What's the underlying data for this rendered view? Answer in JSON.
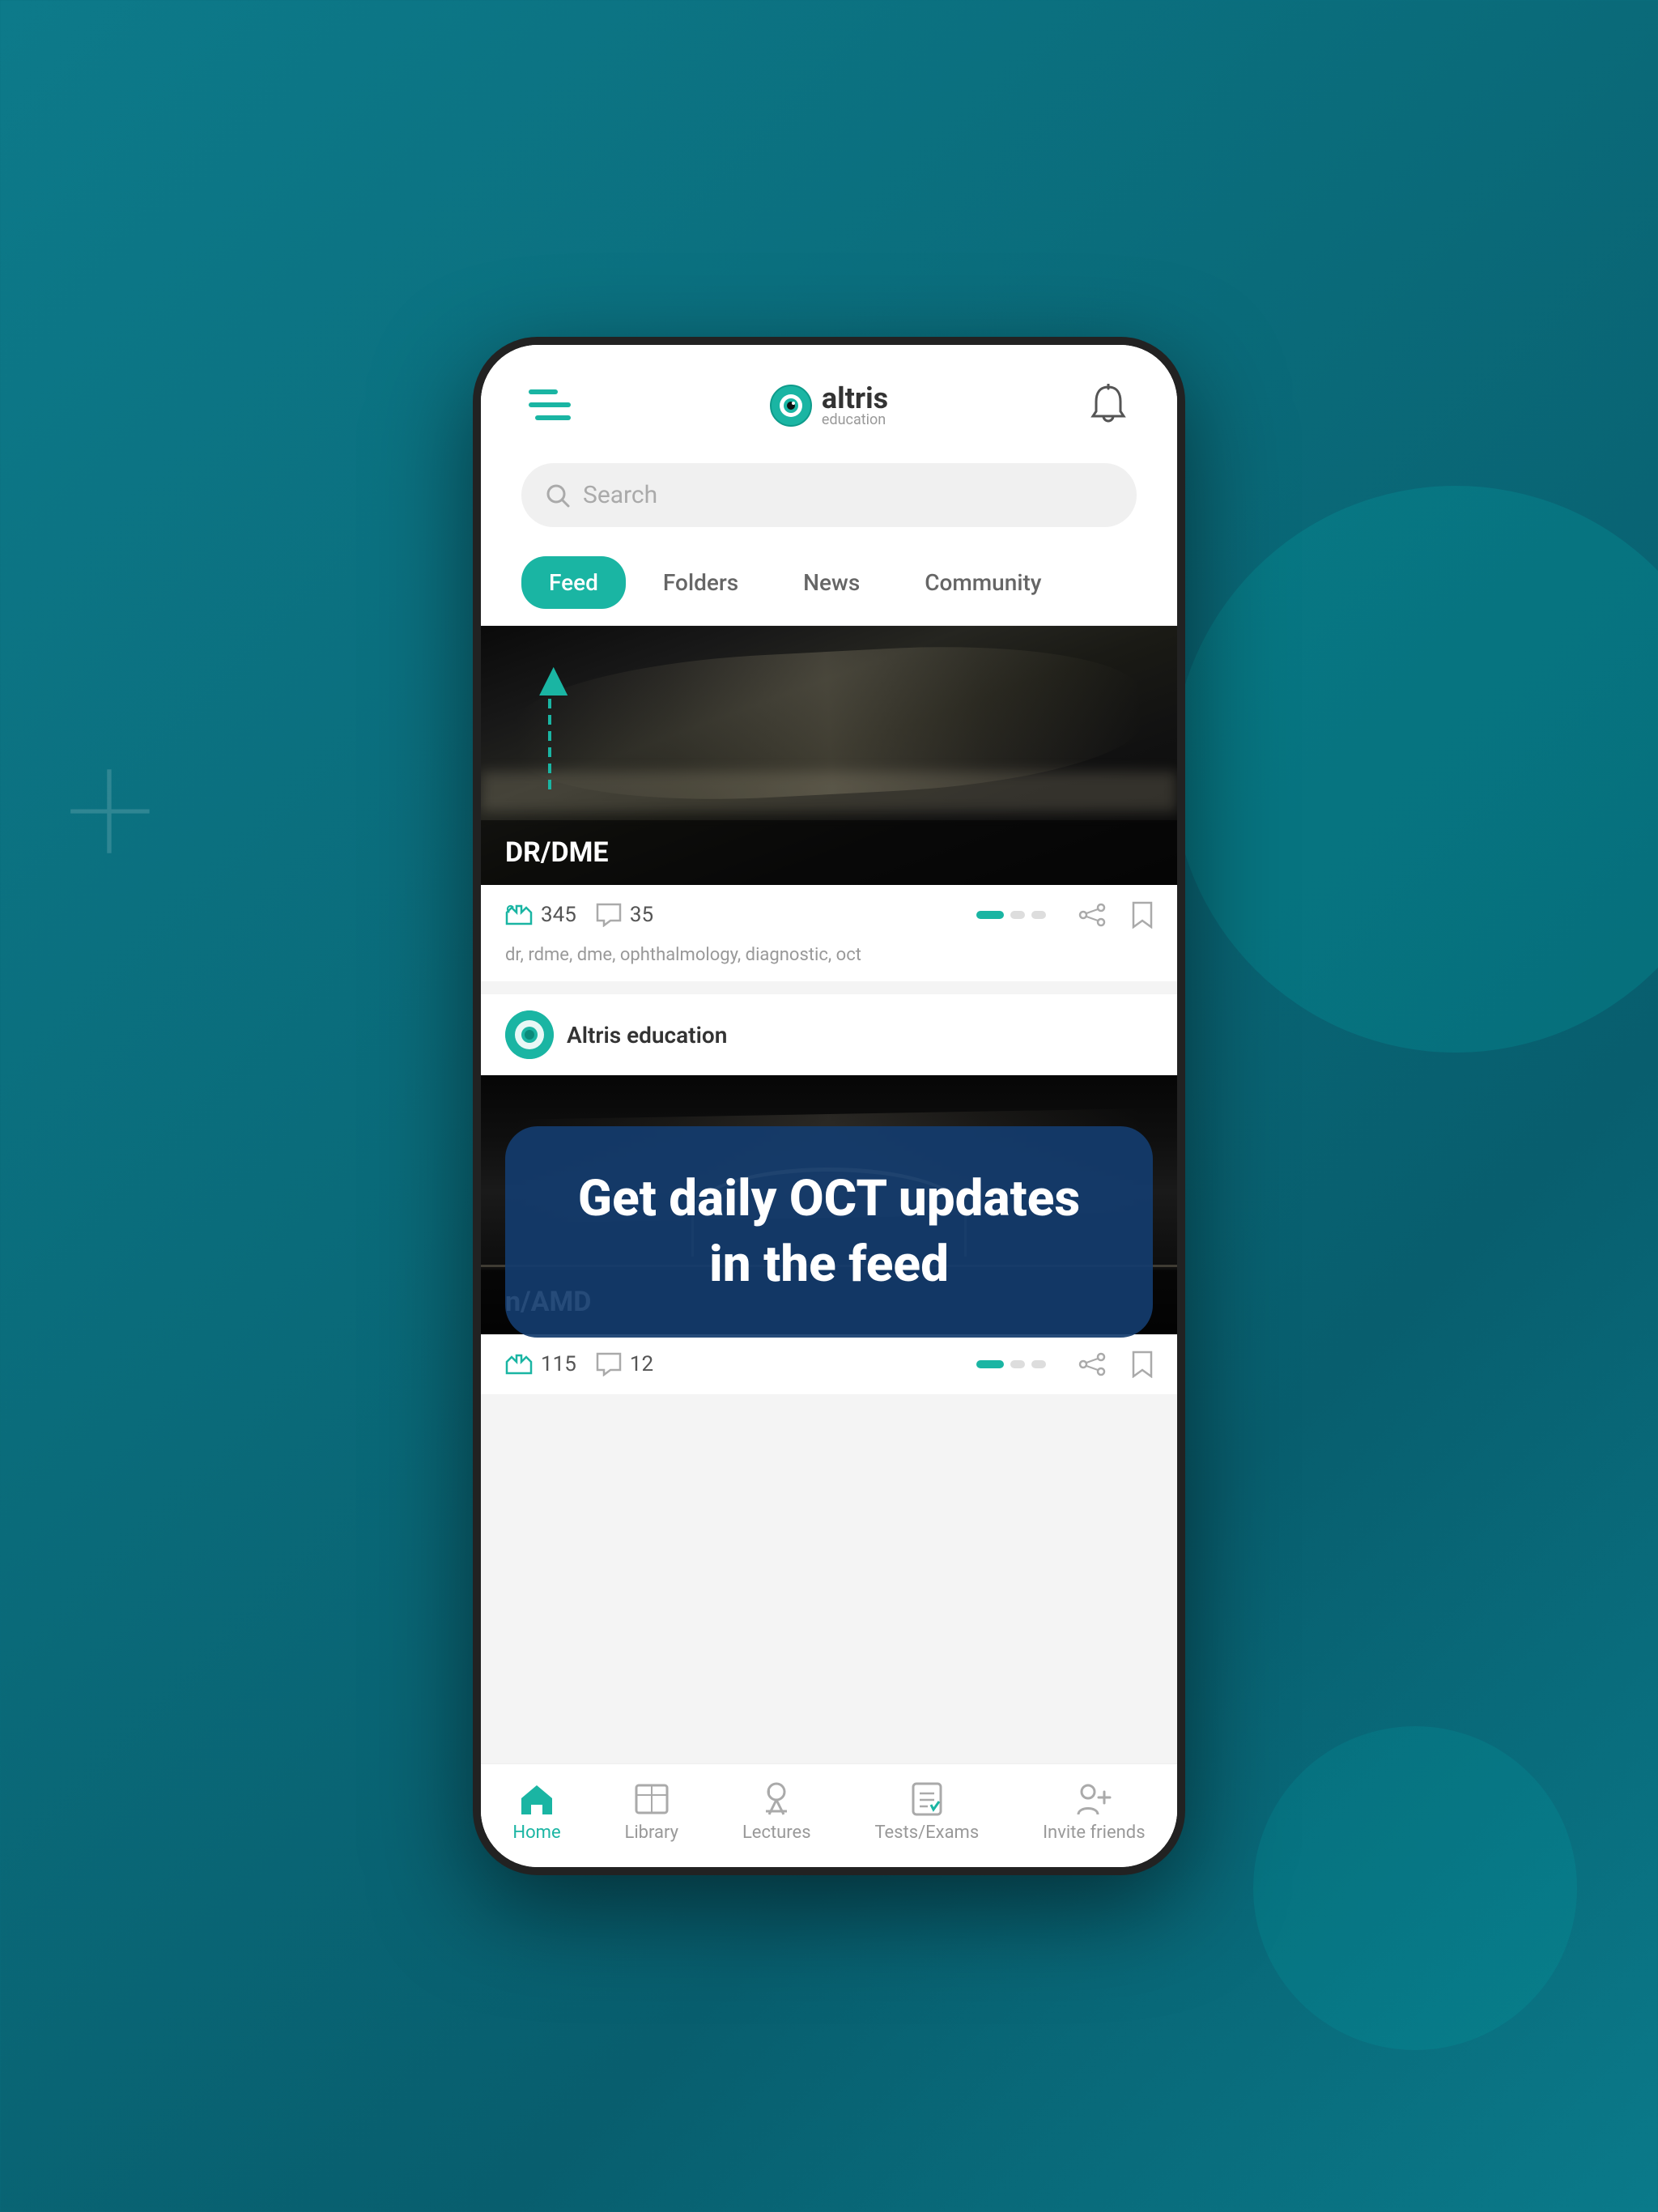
{
  "background": {
    "color1": "#0d7a8a",
    "color2": "#085e6e"
  },
  "header": {
    "logo_name": "altris",
    "logo_sub": "education",
    "bell_label": "notifications"
  },
  "search": {
    "placeholder": "Search"
  },
  "tabs": {
    "items": [
      {
        "label": "Feed",
        "active": true
      },
      {
        "label": "Folders",
        "active": false
      },
      {
        "label": "News",
        "active": false
      },
      {
        "label": "Community",
        "active": false
      }
    ]
  },
  "card1": {
    "image_label": "DR/DME",
    "likes": "345",
    "comments": "35",
    "tags": "dr, rdme, dme, ophthalmology, diagnostic, oct"
  },
  "card2": {
    "author": "Altris education",
    "image_label": "n/AMD",
    "likes": "115",
    "comments": "12"
  },
  "overlay": {
    "line1": "Get daily OCT updates",
    "line2": "in the feed"
  },
  "bottomnav": {
    "items": [
      {
        "label": "Home",
        "active": true
      },
      {
        "label": "Library",
        "active": false
      },
      {
        "label": "Lectures",
        "active": false
      },
      {
        "label": "Tests/Exams",
        "active": false
      },
      {
        "label": "Invite friends",
        "active": false
      }
    ]
  }
}
